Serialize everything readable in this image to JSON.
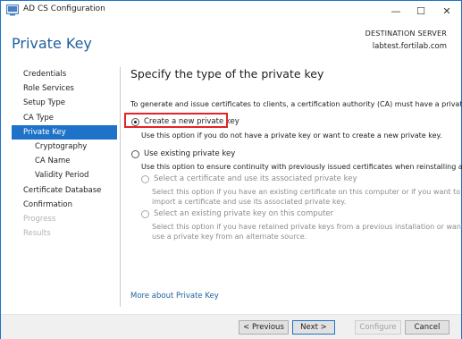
{
  "window": {
    "title": "AD CS Configuration",
    "controls": {
      "minimize": "—",
      "maximize": "☐",
      "close": "✕"
    }
  },
  "header": {
    "page_title": "Private Key",
    "destination_label": "DESTINATION SERVER",
    "destination_value": "labtest.fortilab.com"
  },
  "nav": {
    "items": [
      {
        "label": "Credentials",
        "state": "normal"
      },
      {
        "label": "Role Services",
        "state": "normal"
      },
      {
        "label": "Setup Type",
        "state": "normal"
      },
      {
        "label": "CA Type",
        "state": "normal"
      },
      {
        "label": "Private Key",
        "state": "active"
      },
      {
        "label": "Cryptography",
        "state": "sub"
      },
      {
        "label": "CA Name",
        "state": "sub"
      },
      {
        "label": "Validity Period",
        "state": "sub"
      },
      {
        "label": "Certificate Database",
        "state": "normal"
      },
      {
        "label": "Confirmation",
        "state": "normal"
      },
      {
        "label": "Progress",
        "state": "disabled"
      },
      {
        "label": "Results",
        "state": "disabled"
      }
    ]
  },
  "main": {
    "heading": "Specify the type of the private key",
    "intro": "To generate and issue certificates to clients, a certification authority (CA) must have a private key.",
    "option_new": {
      "label": "Create a new private key",
      "desc": "Use this option if you do not have a private key or want to create a new private key.",
      "selected": true
    },
    "option_existing": {
      "label": "Use existing private key",
      "desc": "Use this option to ensure continuity with previously issued certificates when reinstalling a CA.",
      "selected": false
    },
    "suboption_cert": {
      "label": "Select a certificate and use its associated private key",
      "desc_line1": "Select this option if you have an existing certificate on this computer or if you want to",
      "desc_line2": "import a certificate and use its associated private key."
    },
    "suboption_key": {
      "label": "Select an existing private key on this computer",
      "desc_line1": "Select this option if you have retained private keys from a previous installation or want to",
      "desc_line2": "use a private key from an alternate source."
    },
    "more_link": "More about Private Key"
  },
  "footer": {
    "previous": "< Previous",
    "next": "Next >",
    "configure": "Configure",
    "cancel": "Cancel"
  },
  "colors": {
    "accent": "#1e73c8",
    "highlight": "#e32424"
  }
}
